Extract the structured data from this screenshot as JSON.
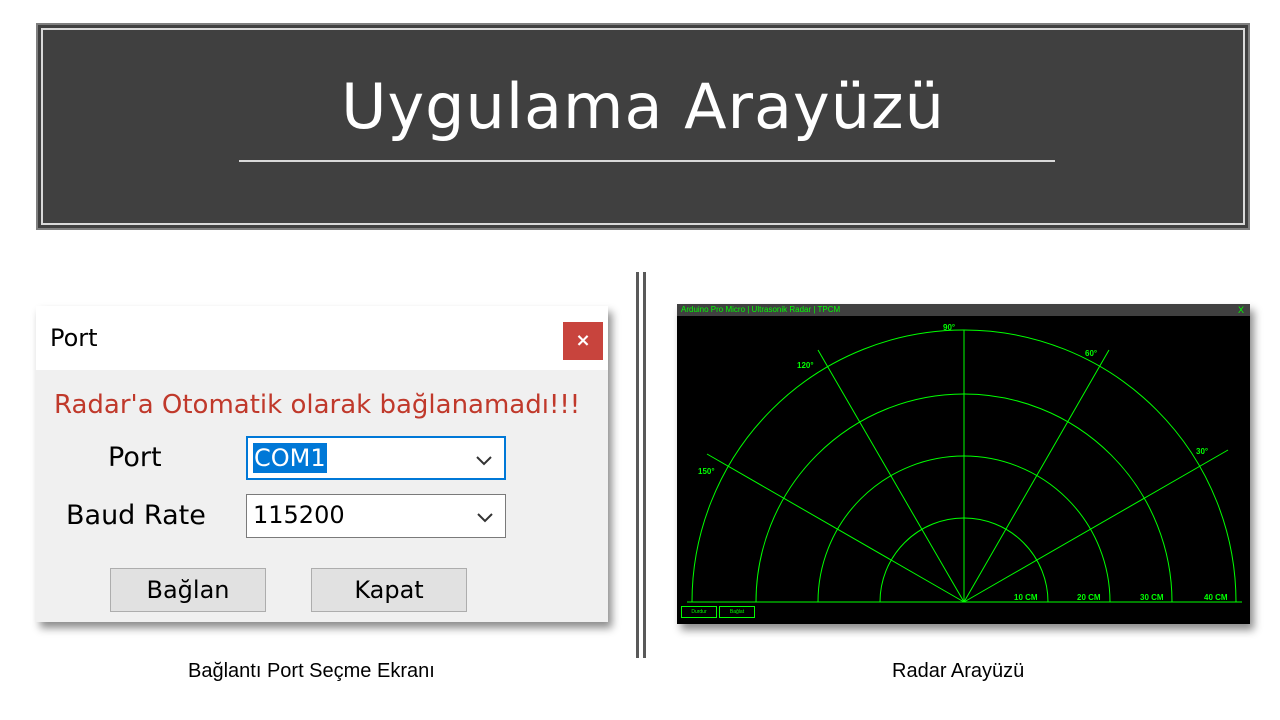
{
  "slide": {
    "title": "Uygulama Arayüzü",
    "left_caption": "Bağlantı Port Seçme Ekranı",
    "right_caption": "Radar Arayüzü"
  },
  "port_dialog": {
    "title": "Port",
    "close_glyph": "×",
    "message": "Radar'a Otomatik olarak bağlanamadı!!!",
    "port_label": "Port",
    "port_value": "COM1",
    "baud_label": "Baud Rate",
    "baud_value": "115200",
    "connect_button": "Bağlan",
    "close_button": "Kapat",
    "message_color": "#c0392b",
    "close_color": "#c8443d"
  },
  "radar_window": {
    "title": "Arduino Pro Micro | Ultrasonik Radar | TPCM",
    "close_glyph": "X",
    "stop_button": "Durdur",
    "connect_button": "Bağlat",
    "color": "#00ff00",
    "angle_labels": [
      "30°",
      "60°",
      "90°",
      "120°",
      "150°"
    ],
    "distance_labels": [
      "10 CM",
      "20 CM",
      "30 CM",
      "40 CM"
    ]
  }
}
